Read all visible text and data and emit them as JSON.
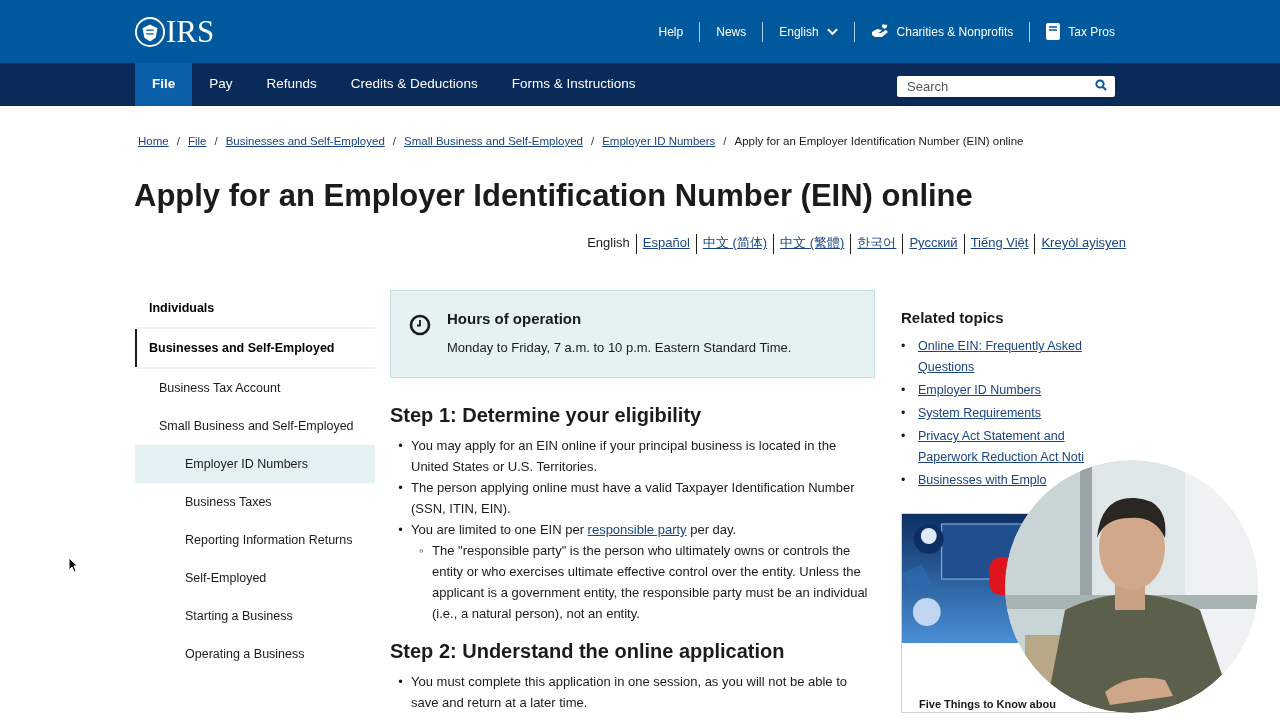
{
  "header": {
    "logo": "IRS",
    "utility_links": [
      {
        "label": "Help",
        "kind": "plain"
      },
      {
        "label": "News",
        "kind": "plain"
      },
      {
        "label": "English",
        "kind": "dropdown"
      },
      {
        "label": "Charities & Nonprofits",
        "kind": "charity"
      },
      {
        "label": "Tax Pros",
        "kind": "book"
      }
    ]
  },
  "nav": {
    "tabs": [
      {
        "label": "File",
        "selected": true
      },
      {
        "label": "Pay",
        "selected": false
      },
      {
        "label": "Refunds",
        "selected": false
      },
      {
        "label": "Credits & Deductions",
        "selected": false
      },
      {
        "label": "Forms & Instructions",
        "selected": false
      }
    ],
    "search": {
      "placeholder": "Search"
    }
  },
  "breadcrumbs": [
    {
      "label": "Home",
      "link": true
    },
    {
      "separator": "/",
      "label": "File",
      "link": true
    },
    {
      "separator": "/",
      "label": "Businesses and Self-Employed",
      "link": true
    },
    {
      "separator": "/",
      "label": "Small Business and Self-Employed",
      "link": true
    },
    {
      "separator": "/",
      "label": "Employer ID Numbers",
      "link": true
    },
    {
      "separator": "/",
      "label": "Apply for an Employer Identification Number (EIN) online",
      "link": false
    }
  ],
  "title": "Apply for an Employer Identification Number (EIN) online",
  "languages": [
    {
      "label": "English",
      "selected": true
    },
    {
      "label": "Español",
      "selected": false
    },
    {
      "label": "中文 (简体)",
      "selected": false
    },
    {
      "label": "中文 (繁體)",
      "selected": false
    },
    {
      "label": "한국어",
      "selected": false
    },
    {
      "label": "Русский",
      "selected": false
    },
    {
      "label": "Tiếng Việt",
      "selected": false
    },
    {
      "label": "Kreyòl ayisyen",
      "selected": false
    }
  ],
  "sidebar": {
    "items": [
      {
        "label": "Individuals",
        "selected": false,
        "expanded": false
      },
      {
        "label": "Businesses and Self-Employed",
        "selected": false,
        "expanded": true,
        "children": [
          {
            "label": "Business Tax Account",
            "selected": false
          },
          {
            "label": "Small Business and Self-Employed",
            "selected": false,
            "children": [
              {
                "label": "Employer ID Numbers",
                "selected": true
              },
              {
                "label": "Business Taxes",
                "selected": false
              },
              {
                "label": "Reporting Information Returns",
                "selected": false
              },
              {
                "label": "Self-Employed",
                "selected": false
              },
              {
                "label": "Starting a Business",
                "selected": false
              },
              {
                "label": "Operating a Business",
                "selected": false
              }
            ]
          }
        ]
      }
    ]
  },
  "hours": {
    "title": "Hours of operation",
    "text": "Monday to Friday, 7 a.m. to 10 p.m. Eastern Standard Time."
  },
  "sections": [
    {
      "heading": "Step 1: Determine your eligibility",
      "bullets": [
        {
          "marker": "•",
          "segments": [
            {
              "text": "You may apply for an EIN online if your principal business is located in the United States or U.S. Territories.",
              "link": false
            }
          ]
        },
        {
          "marker": "•",
          "segments": [
            {
              "text": "The person applying online must have a valid Taxpayer Identification Number (SSN, ITIN, EIN).",
              "link": false
            }
          ]
        },
        {
          "marker": "•",
          "segments": [
            {
              "text": "You are limited to one EIN per ",
              "link": false
            },
            {
              "text": "responsible party",
              "link": true
            },
            {
              "text": " per day.",
              "link": false
            }
          ],
          "children": [
            {
              "marker": "◦",
              "segments": [
                {
                  "text": "The \"responsible party\" is the person who ultimately owns or controls the entity or who exercises ultimate effective control over the entity. Unless the applicant is a government entity, the responsible party must be an individual (i.e., a natural person), not an entity.",
                  "link": false
                }
              ]
            }
          ]
        }
      ]
    },
    {
      "heading": "Step 2: Understand the online application",
      "bullets": [
        {
          "marker": "•",
          "segments": [
            {
              "text": "You must complete this application in one session, as you will not be able to save and return at a later time.",
              "link": false
            }
          ]
        }
      ]
    }
  ],
  "related": {
    "title": "Related topics",
    "links": [
      {
        "marker": "•",
        "label": "Online EIN: Frequently Asked Questions"
      },
      {
        "marker": "•",
        "label": "Employer ID Numbers"
      },
      {
        "marker": "•",
        "label": "System Requirements"
      },
      {
        "marker": "•",
        "label": "Privacy Act Statement and Paperwork Reduction Act Noti"
      },
      {
        "marker": "•",
        "label": "Businesses with Emplo"
      }
    ]
  },
  "video": {
    "title": "Five Things to Know abou"
  }
}
